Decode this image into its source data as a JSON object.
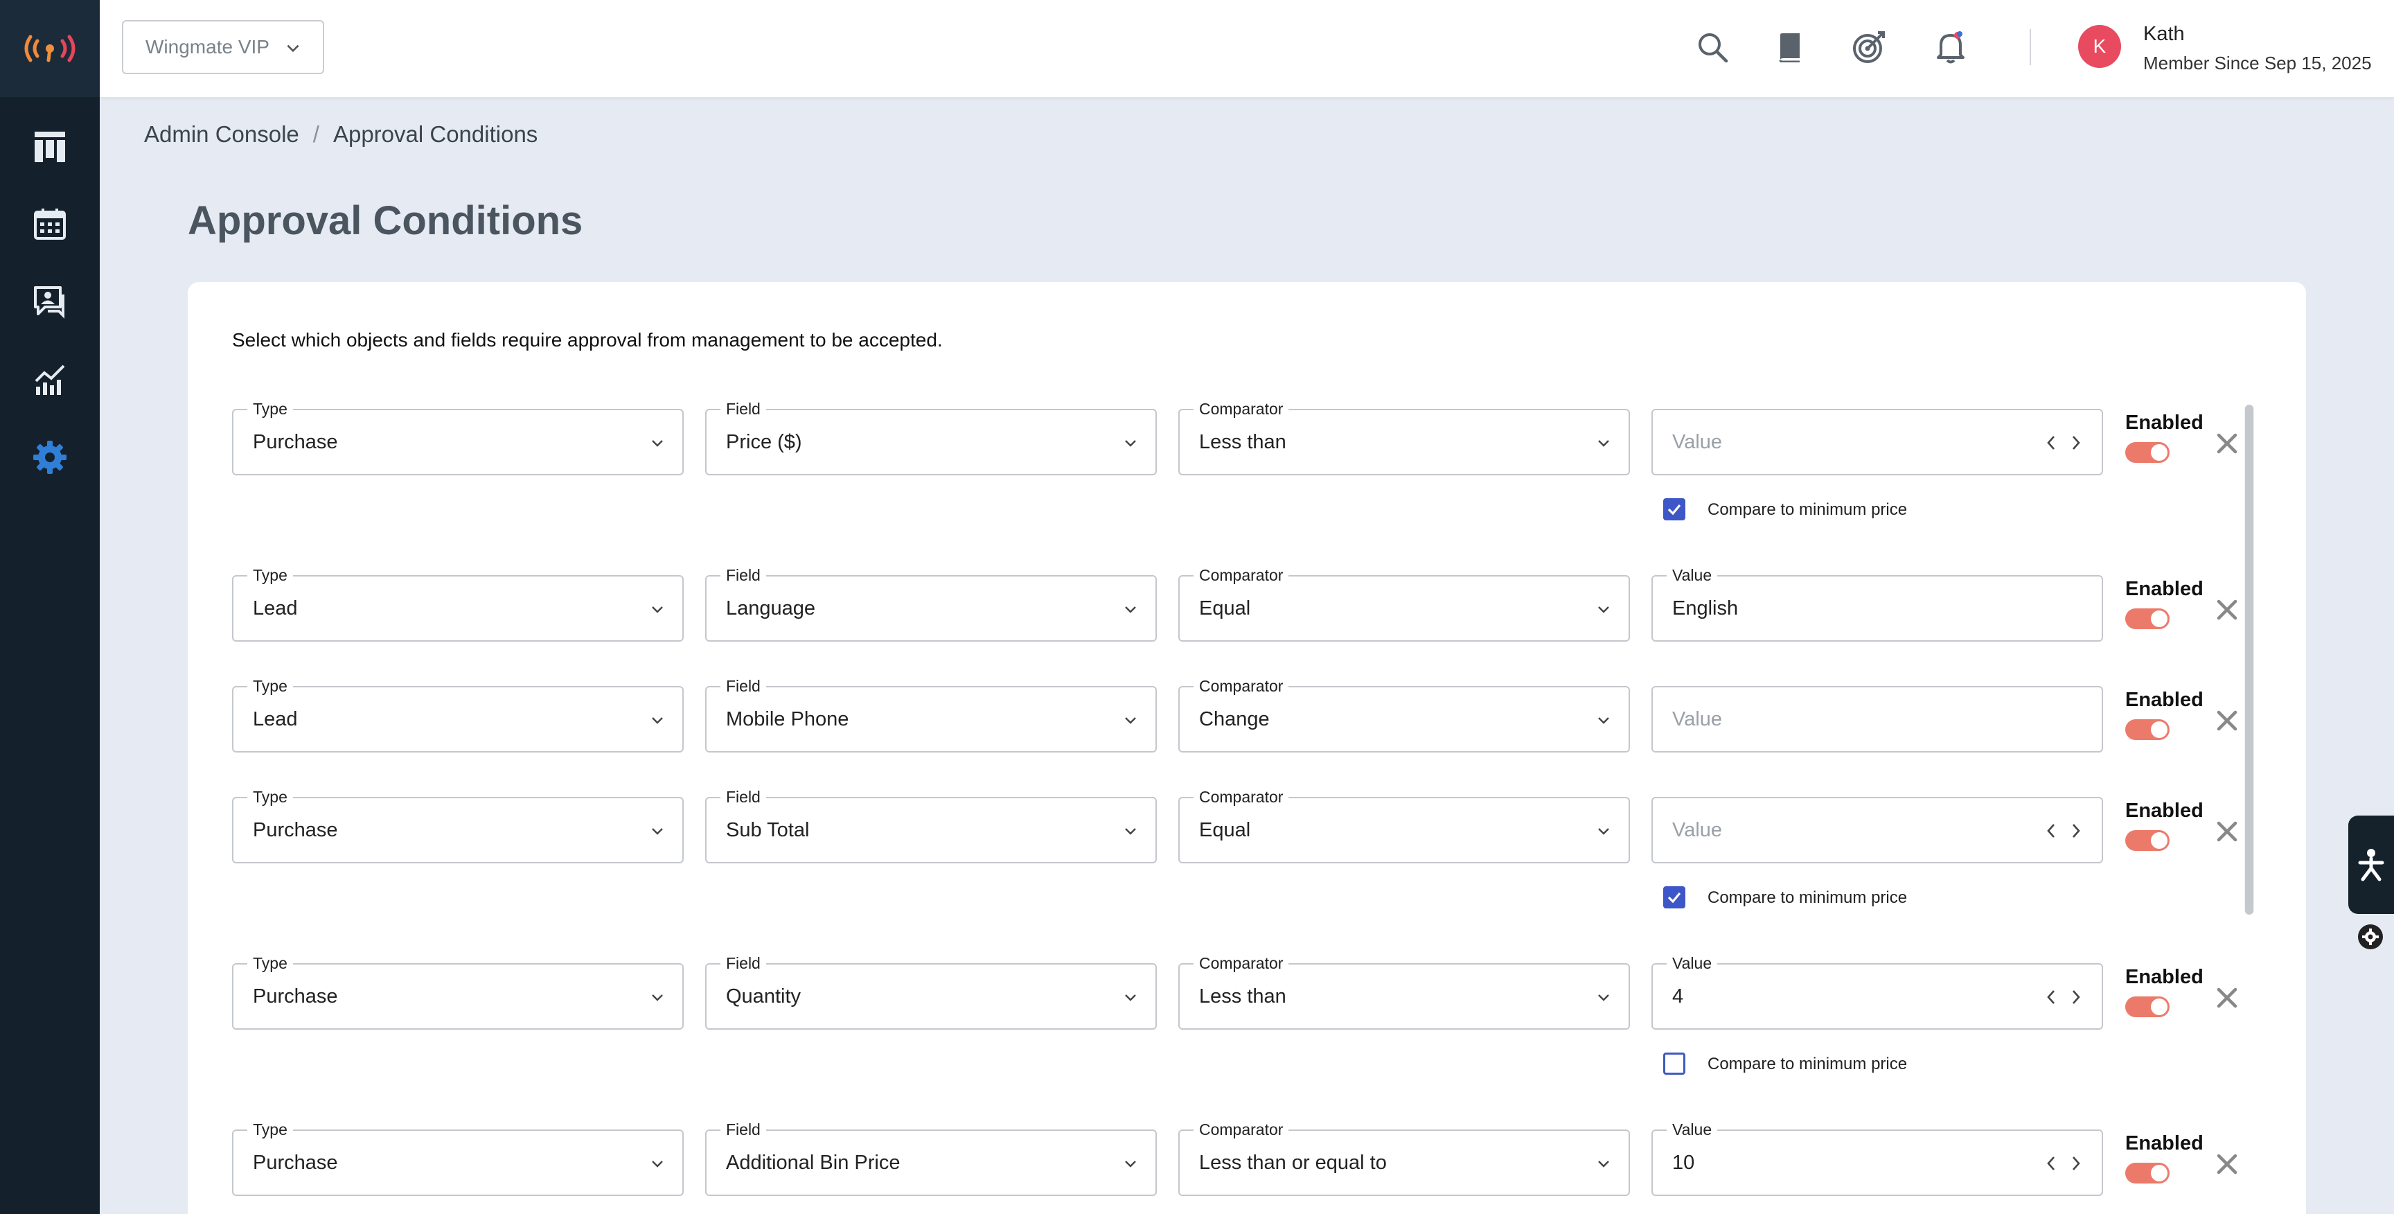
{
  "header": {
    "org_selector": "Wingmate VIP",
    "user": {
      "initial": "K",
      "name": "Kath",
      "subtitle": "Member Since Sep 15, 2025"
    }
  },
  "breadcrumb": {
    "items": [
      "Admin Console",
      "Approval Conditions"
    ],
    "separator": "/"
  },
  "page": {
    "title": "Approval Conditions",
    "description": "Select which objects and fields require approval from management to be accepted."
  },
  "labels": {
    "type": "Type",
    "field": "Field",
    "comparator": "Comparator",
    "value": "Value",
    "enabled": "Enabled",
    "compare_min": "Compare to minimum price"
  },
  "conditions": [
    {
      "type": "Purchase",
      "field": "Price ($)",
      "comparator": "Less than",
      "value": "",
      "value_placeholder": "Value",
      "stepper": true,
      "compare_min": true,
      "enabled": true
    },
    {
      "type": "Lead",
      "field": "Language",
      "comparator": "Equal",
      "value": "English",
      "value_placeholder": "Value",
      "stepper": false,
      "compare_min": null,
      "enabled": true
    },
    {
      "type": "Lead",
      "field": "Mobile Phone",
      "comparator": "Change",
      "value": "",
      "value_placeholder": "Value",
      "stepper": false,
      "compare_min": null,
      "enabled": true
    },
    {
      "type": "Purchase",
      "field": "Sub Total",
      "comparator": "Equal",
      "value": "",
      "value_placeholder": "Value",
      "stepper": true,
      "compare_min": true,
      "enabled": true
    },
    {
      "type": "Purchase",
      "field": "Quantity",
      "comparator": "Less than",
      "value": "4",
      "value_placeholder": "Value",
      "stepper": true,
      "compare_min": false,
      "enabled": true
    },
    {
      "type": "Purchase",
      "field": "Additional Bin Price",
      "comparator": "Less than or equal to",
      "value": "10",
      "value_placeholder": "Value",
      "stepper": true,
      "compare_min": null,
      "enabled": true
    }
  ],
  "colors": {
    "sidebar": "#14202c",
    "accent_blue": "#2f7fd8",
    "toggle_on": "#ec7a6a",
    "checkbox": "#3d56c8",
    "avatar": "#e84a5f"
  },
  "icons": {
    "sidebar": [
      "dashboard-icon",
      "calendar-icon",
      "messages-icon",
      "analytics-icon",
      "settings-gear-icon"
    ],
    "topbar": [
      "search-icon",
      "book-icon",
      "target-icon",
      "bell-icon"
    ]
  }
}
